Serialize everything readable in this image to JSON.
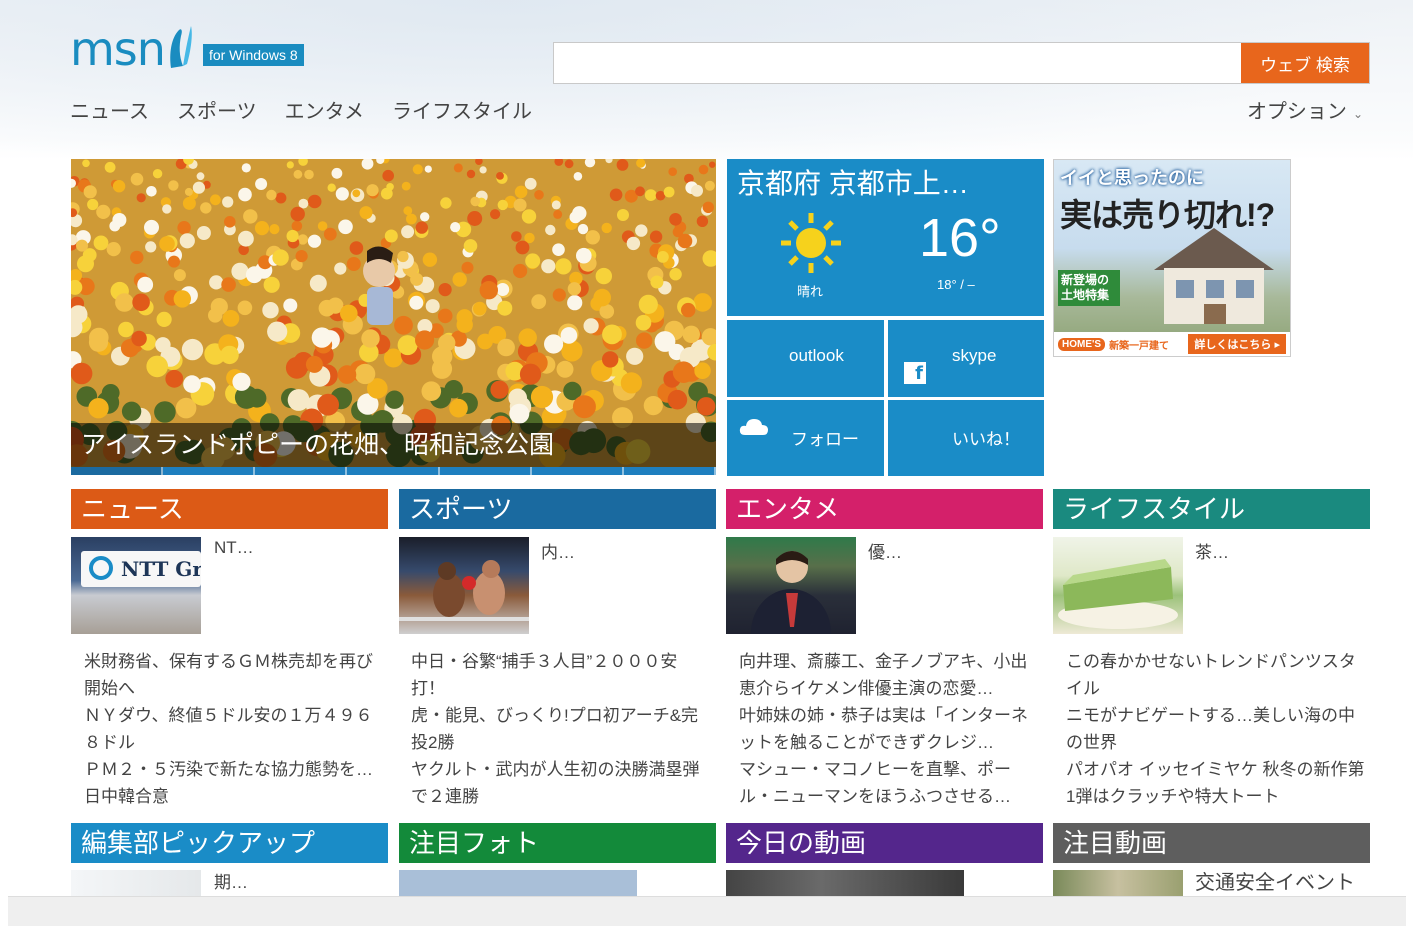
{
  "header": {
    "logo_text": "msn",
    "logo_badge": "for Windows 8",
    "search": {
      "value": "",
      "placeholder": "",
      "button_label": "ウェブ 検索"
    },
    "nav": [
      "ニュース",
      "スポーツ",
      "エンタメ",
      "ライフスタイル"
    ],
    "options_label": "オプション",
    "options_chevron": "⌄"
  },
  "hero": {
    "caption": "アイスランドポピーの花畑、昭和記念公園",
    "slide_count": 7,
    "active_slide": 1
  },
  "weather": {
    "location": "京都府 京都市上…",
    "temperature": "16°",
    "condition": "晴れ",
    "range": "18° / –"
  },
  "tiles": {
    "outlook": "outlook",
    "skype": "skype",
    "follow": "フォロー",
    "like": "いいね！",
    "facebook_icon": "f"
  },
  "ad": {
    "line1": "イイと思ったのに",
    "line2": "実は売り切れ!?",
    "tag": "新登場の土地特集",
    "logo": "HOME'S",
    "sub": "新築一戸建て",
    "cta": "詳しくはこちら ▸"
  },
  "categories": [
    {
      "title": "ニュース",
      "thumb_title": "NT…",
      "thumb_sign": "NTT Gr",
      "headlines": [
        "米財務省、保有するＧＭ株売却を再び開始へ",
        "ＮＹダウ、終値５ドル安の１万４９６８ドル",
        "ＰＭ２・５汚染で新たな協力態勢を…日中韓合意"
      ]
    },
    {
      "title": "スポーツ",
      "thumb_title": "内…",
      "headlines": [
        "中日・谷繁“捕手３人目”２０００安打！",
        "虎・能見、びっくり!プロ初アーチ&完投2勝",
        "ヤクルト・武内が人生初の決勝満塁弾で２連勝"
      ]
    },
    {
      "title": "エンタメ",
      "thumb_title": "優…",
      "headlines": [
        "向井理、斎藤工、金子ノブアキ、小出恵介らイケメン俳優主演の恋愛…",
        "叶姉妹の姉・恭子は実は「インターネットを触ることができずクレジ…",
        "マシュー・マコノヒーを直撃、ポール・ニューマンをほうふつさせる…"
      ]
    },
    {
      "title": "ライフスタイル",
      "thumb_title": "茶…",
      "headlines": [
        "この春かかせないトレンドパンツスタイル",
        "ニモがナビゲートする…美しい海の中の世界",
        "パオパオ イッセイミヤケ 秋冬の新作第1弾はクラッチや特大トート"
      ]
    }
  ],
  "sections2": [
    {
      "title": "編集部ピックアップ",
      "thumb_title": "期…"
    },
    {
      "title": "注目フォト",
      "thumb_title": ""
    },
    {
      "title": "今日の動画",
      "thumb_title": ""
    },
    {
      "title": "注目動画",
      "thumb_title": "交通安全イベント"
    }
  ],
  "colors": {
    "msn_blue": "#1a8cc0",
    "search_orange": "#e8661c",
    "news": "#dc5a16",
    "sports": "#1a6aa0",
    "entertainment": "#d4206a",
    "lifestyle": "#1a8a7f",
    "pickup": "#1a8cc7",
    "photo": "#138a3a",
    "video": "#54268c",
    "hot_video": "#5e5e5e"
  }
}
